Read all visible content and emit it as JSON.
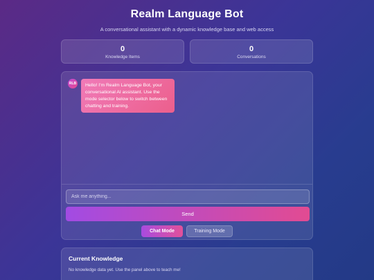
{
  "header": {
    "title": "Realm Language Bot",
    "subtitle": "A conversational assistant with a dynamic knowledge base and web access"
  },
  "stats": [
    {
      "value": "0",
      "label": "Knowledge Items"
    },
    {
      "value": "0",
      "label": "Conversations"
    }
  ],
  "chat": {
    "avatar_initials": "RLB",
    "messages": [
      {
        "sender": "bot",
        "text": "Hello! I'm Realm Language Bot, your conversational AI assistant. Use the mode selector below to switch between chatting and training."
      }
    ],
    "input_placeholder": "Ask me anything...",
    "input_value": "",
    "send_label": "Send",
    "modes": [
      {
        "label": "Chat Mode",
        "active": true
      },
      {
        "label": "Training Mode",
        "active": false
      }
    ]
  },
  "knowledge": {
    "title": "Current Knowledge",
    "empty_text": "No knowledge data yet. Use the panel above to teach me!"
  },
  "colors": {
    "accent_purple": "#a24be3",
    "accent_pink": "#e24b92",
    "bubble_pink": "#ec5f8c"
  }
}
